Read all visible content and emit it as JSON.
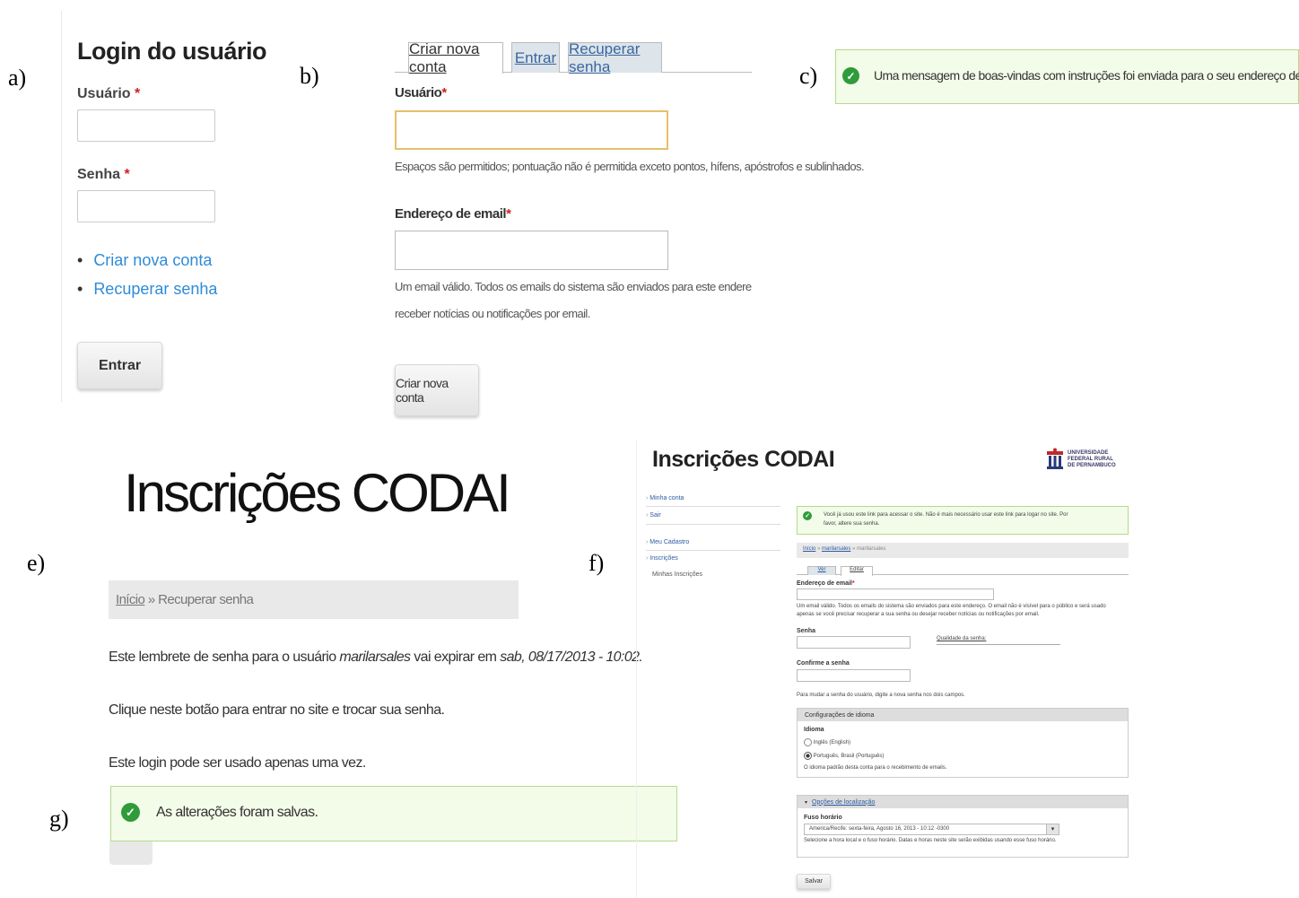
{
  "labels": {
    "a": "a)",
    "b": "b)",
    "c": "c)",
    "e": "e)",
    "f": "f)",
    "g": "g)"
  },
  "panel_a": {
    "title": "Login do usuário",
    "username_label": "Usuário",
    "password_label": "Senha",
    "required_mark": "*",
    "links": [
      "Criar nova conta",
      "Recuperar senha"
    ],
    "submit_label": "Entrar"
  },
  "panel_b": {
    "tabs": [
      "Criar nova conta",
      "Entrar",
      "Recuperar senha"
    ],
    "username_label": "Usuário",
    "required_mark": "*",
    "username_help": "Espaços são permitidos; pontuação não é permitida exceto pontos, hífens, apóstrofos e sublinhados.",
    "email_label": "Endereço de email",
    "email_help_1": "Um email válido. Todos os emails do sistema são enviados para este endereço. O email não é visível",
    "email_help_2": "receber notícias ou notificações por email.",
    "submit_label": "Criar nova conta"
  },
  "panel_c": {
    "message": "Uma mensagem de boas-vindas com instruções foi enviada para o seu endereço de e-mail."
  },
  "panel_e": {
    "site_title": "Inscrições CODAI",
    "breadcrumb_home": "Início",
    "breadcrumb_sep": "»",
    "breadcrumb_current": "Recuperar senha",
    "line1_pre": "Este lembrete de senha para o usuário ",
    "line1_user": "marilarsales",
    "line1_mid": " vai expirar em ",
    "line1_date": "sab, 08/17/2013 - 10:02.",
    "line2": "Clique neste botão para entrar no site e trocar sua senha.",
    "line3": "Este login pode ser usado apenas uma vez."
  },
  "panel_g": {
    "message": "As alterações foram salvas."
  },
  "panel_f": {
    "site_title": "Inscrições CODAI",
    "logo_text": [
      "UNIVERSIDADE",
      "FEDERAL RURAL",
      "DE PERNAMBUCO"
    ],
    "nav": [
      "Minha conta",
      "Sair",
      "Meu Cadastro",
      "Inscrições",
      "Minhas Inscrições"
    ],
    "status_message_1": "Você já usou este link para acessar o site. Não é mais necessário usar este link para logar no site. Por",
    "status_message_2": "favor, altere sua senha.",
    "breadcrumb_home": "Início",
    "breadcrumb_mid": "marilarsales",
    "breadcrumb_current": "marilarsales",
    "breadcrumb_sep": "»",
    "tabs": [
      "Ver",
      "Editar"
    ],
    "email_label": "Endereço de email",
    "required_mark": "*",
    "email_help_1": "Um email válido. Todos os emails do sistema são enviados para este endereço. O email não é visível para o público e será usado",
    "email_help_2": "apenas se você precisar recuperar a sua senha ou desejar receber notícias ou notificações por email.",
    "password_label": "Senha",
    "password_strength": "Qualidade da senha:",
    "confirm_label": "Confirme a senha",
    "password_help": "Para mudar a senha do usuário, digite a nova senha nos dois campos.",
    "lang_legend": "Configurações de idioma",
    "lang_label": "Idioma",
    "lang_options": [
      "Inglês (English)",
      "Português, Brasil (Português)"
    ],
    "lang_selected": "Português, Brasil (Português)",
    "lang_help": "O idioma padrão desta conta para o recebimento de emails.",
    "loc_legend": "Opções de localização",
    "tz_label": "Fuso horário",
    "tz_value": "America/Recife: sexta-feira, Agosto 16, 2013 - 10:12 -0300",
    "tz_help": "Selecione a hora local e o fuso horário. Datas e horas neste site serão exibidas usando esse fuso horário.",
    "save_label": "Salvar"
  }
}
